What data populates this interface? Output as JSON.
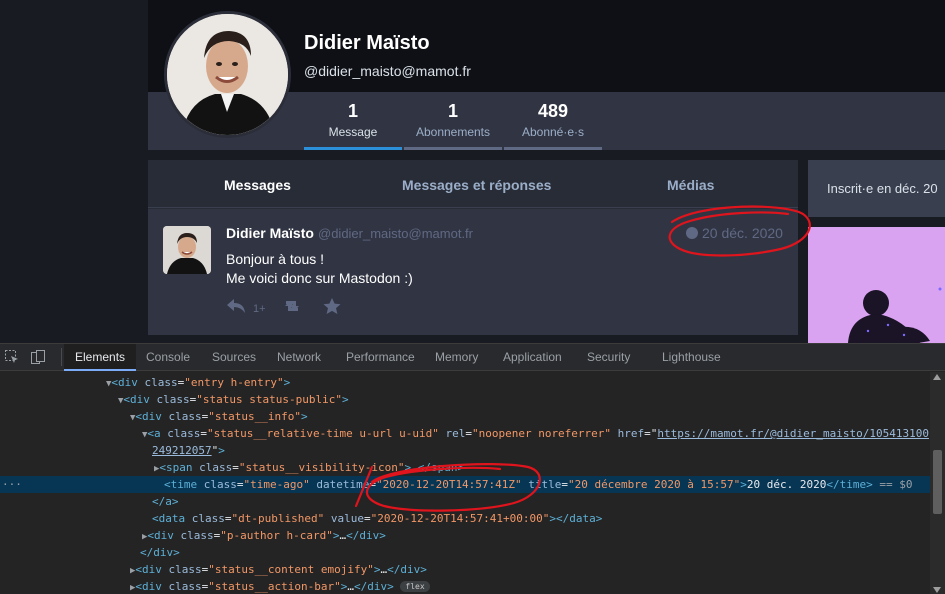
{
  "colors": {
    "accent": "#2b90d9",
    "annotation": "#e0141c",
    "devtools_selection": "#073655"
  },
  "profile": {
    "display_name": "Didier Maïsto",
    "acct": "@didier_maisto@mamot.fr",
    "counters": [
      {
        "value": "1",
        "label": "Message",
        "active": true
      },
      {
        "value": "1",
        "label": "Abonnements",
        "active": false
      },
      {
        "value": "489",
        "label": "Abonné·e·s",
        "active": false
      }
    ]
  },
  "timeline": {
    "tabs": [
      {
        "label": "Messages",
        "active": true
      },
      {
        "label": "Messages et réponses",
        "active": false
      },
      {
        "label": "Médias",
        "active": false
      }
    ]
  },
  "status": {
    "author_name": "Didier Maïsto",
    "author_acct": "@didier_maisto@mamot.fr",
    "visibility_icon": "globe-icon",
    "timestamp": "20 déc. 2020",
    "content_line1": "Bonjour à tous !",
    "content_line2": "Me voici donc sur Mastodon :)",
    "reply_count": "1+"
  },
  "sidebar": {
    "joined": "Inscrit·e en déc. 20"
  },
  "devtools": {
    "tabs": [
      {
        "label": "Elements",
        "active": true
      },
      {
        "label": "Console",
        "active": false
      },
      {
        "label": "Sources",
        "active": false
      },
      {
        "label": "Network",
        "active": false
      },
      {
        "label": "Performance",
        "active": false
      },
      {
        "label": "Memory",
        "active": false
      },
      {
        "label": "Application",
        "active": false
      },
      {
        "label": "Security",
        "active": false
      },
      {
        "label": "Lighthouse",
        "active": false
      }
    ],
    "dom": {
      "l1_tag": "<div",
      "l1_attr": "class",
      "l1_val": "\"entry h-entry\"",
      "l2_val": "\"status status-public\"",
      "l3_val": "\"status__info\"",
      "l4_class_val": "\"status__relative-time u-url u-uid\"",
      "l4_rel_val": "\"noopener noreferrer\"",
      "l4_href_val": "https://mamot.fr/@didier_maisto/105413100",
      "l5_href_cont": "249212057",
      "l6_val": "\"status__visibility-icon\"",
      "l7_class_val": "\"time-ago\"",
      "l7_datetime_val": "\"2020-12-20T14:57:41Z\"",
      "l7_title_val": "\"20 décembre 2020 à 15:57\"",
      "l7_text": "20 déc. 2020",
      "l7_eq": "== $0",
      "l9_class_val": "\"dt-published\"",
      "l9_value_val": "\"2020-12-20T14:57:41+00:00\"",
      "l10_val": "\"p-author h-card\"",
      "l12_val": "\"status__content emojify\"",
      "l13_val": "\"status__action-bar\"",
      "flex_badge": "flex",
      "ellipsis": "…",
      "dots": "···"
    }
  }
}
